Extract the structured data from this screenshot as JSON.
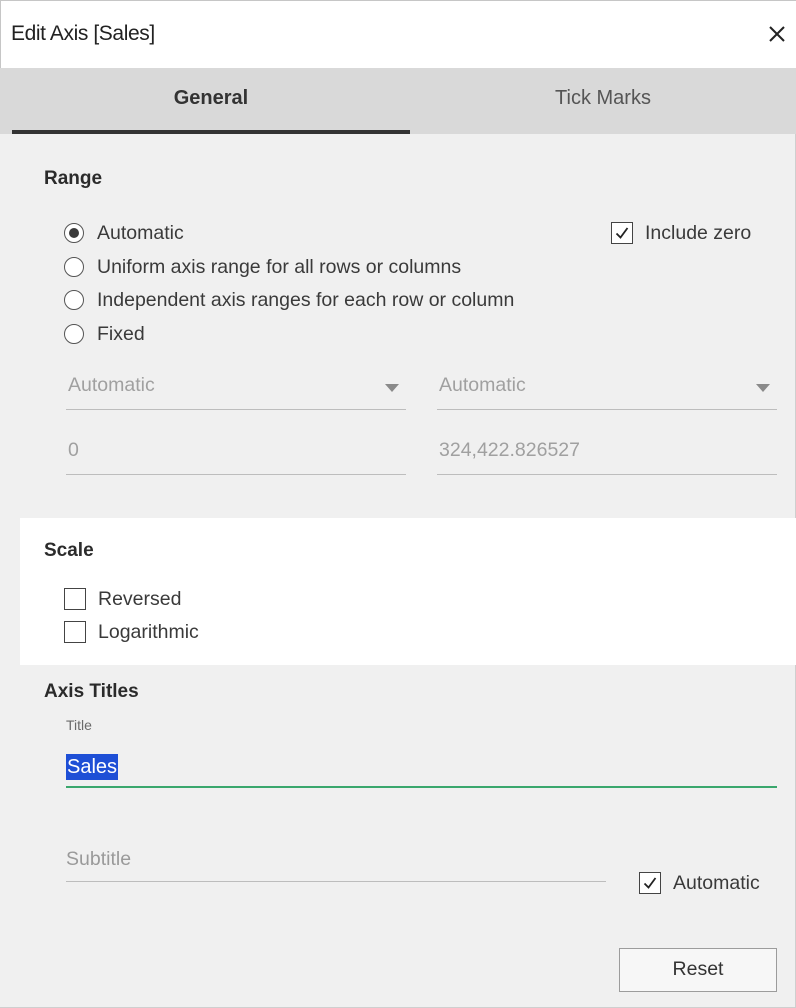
{
  "dialog": {
    "title": "Edit Axis [Sales]",
    "close_glyph": "close-icon"
  },
  "tabs": [
    {
      "label": "General",
      "active": true
    },
    {
      "label": "Tick Marks",
      "active": false
    }
  ],
  "range": {
    "heading": "Range",
    "options": [
      {
        "label": "Automatic",
        "selected": true
      },
      {
        "label": "Uniform axis range for all rows or columns",
        "selected": false
      },
      {
        "label": "Independent axis ranges for each row or column",
        "selected": false
      },
      {
        "label": "Fixed",
        "selected": false
      }
    ],
    "include_zero": {
      "label": "Include zero",
      "checked": true
    },
    "start_mode": "Automatic",
    "end_mode": "Automatic",
    "start_value": "0",
    "end_value": "324,422.826527"
  },
  "scale": {
    "heading": "Scale",
    "reversed": {
      "label": "Reversed",
      "checked": false
    },
    "logarithmic": {
      "label": "Logarithmic",
      "checked": false
    }
  },
  "axis_titles": {
    "heading": "Axis Titles",
    "title_label": "Title",
    "title_value": "Sales",
    "subtitle_placeholder": "Subtitle",
    "automatic": {
      "label": "Automatic",
      "checked": true
    }
  },
  "buttons": {
    "reset_label": "Reset"
  },
  "colors": {
    "accent_underline": "#3aa76d",
    "selection_highlight": "#1e4fd6",
    "panel_background": "#f0f0f0",
    "tab_bar_background": "#d9d9d9"
  }
}
